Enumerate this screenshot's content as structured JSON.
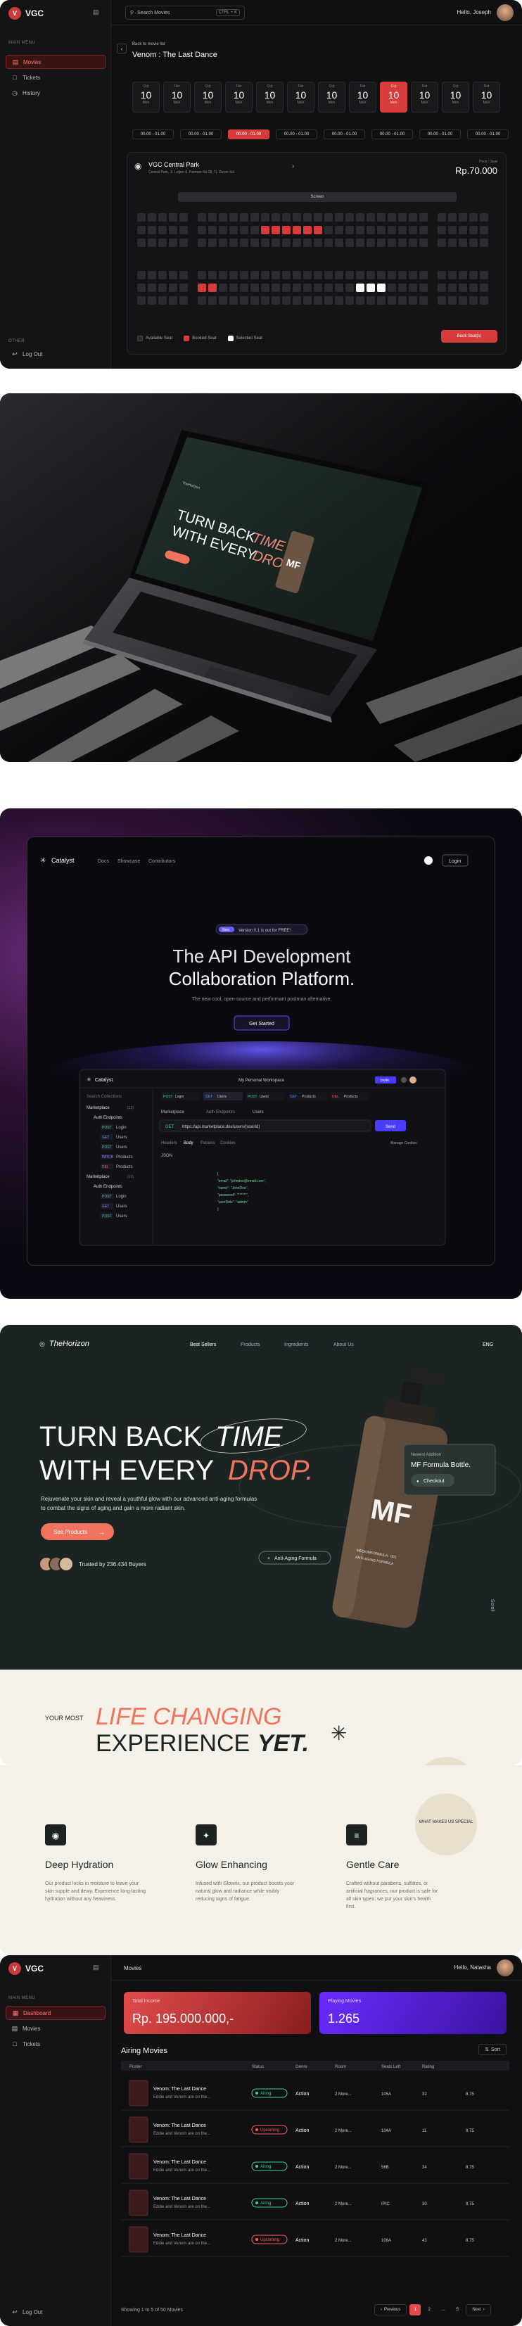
{
  "panel1": {
    "logo": "VGC",
    "sidebar": {
      "section_main": "MAIN MENU",
      "items": [
        {
          "label": "Movies",
          "icon": "film-icon"
        },
        {
          "label": "Tickets",
          "icon": "ticket-icon"
        },
        {
          "label": "History",
          "icon": "history-icon"
        }
      ],
      "section_other": "OTHER",
      "logout": "Log Out"
    },
    "search": {
      "placeholder": "Search Movies",
      "shortcut": "CTRL + K"
    },
    "greeting": "Hello, Joseph",
    "back_label": "Back to movie list",
    "movie_title": "Venom : The Last Dance",
    "dates": [
      {
        "m": "Oct",
        "d": "10",
        "w": "Mon"
      },
      {
        "m": "Oct",
        "d": "10",
        "w": "Mon"
      },
      {
        "m": "Oct",
        "d": "10",
        "w": "Mon"
      },
      {
        "m": "Oct",
        "d": "10",
        "w": "Mon"
      },
      {
        "m": "Oct",
        "d": "10",
        "w": "Mon"
      },
      {
        "m": "Oct",
        "d": "10",
        "w": "Mon"
      },
      {
        "m": "Oct",
        "d": "10",
        "w": "Mon"
      },
      {
        "m": "Oct",
        "d": "10",
        "w": "Mon"
      },
      {
        "m": "Oct",
        "d": "10",
        "w": "Mon"
      },
      {
        "m": "Oct",
        "d": "10",
        "w": "Mon"
      },
      {
        "m": "Oct",
        "d": "10",
        "w": "Mon"
      },
      {
        "m": "Oct",
        "d": "10",
        "w": "Mon"
      }
    ],
    "selected_date": 8,
    "times": [
      "00.00 - 01.00",
      "00.00 - 01.00",
      "00.00 - 01.00",
      "00.00 - 01.00",
      "00.00 - 01.00",
      "00.00 - 01.00",
      "00.00 - 01.00",
      "00.00 - 01.00"
    ],
    "selected_time": 2,
    "theatre": {
      "name": "VGC Central Park",
      "address": "Central Park, Jl. Letjen S. Parman No.28, Tj. Duren Sel.",
      "price_label": "Price / Seat",
      "price": "Rp.70.000"
    },
    "screen_label": "Screen",
    "legend": {
      "available": "Available Seat",
      "booked": "Booked Seat",
      "selected": "Selected Seat"
    },
    "book_button": "Book Seat(s)",
    "colors": {
      "accent": "#d63c3c",
      "seat": "#2c2c30",
      "selected": "#ffffff"
    }
  },
  "panel2": {
    "brand": "TheHorizon",
    "headline_1": "TURN BACK",
    "headline_1b": "TIME",
    "headline_2": "WITH EVERY",
    "headline_2b": "DROP.",
    "bottle_mark": "MF"
  },
  "panel3": {
    "brand": "Catalyst",
    "nav": [
      "Docs",
      "Showcase",
      "Contributors"
    ],
    "login": "Login",
    "badge_tag": "New",
    "badge_text": "Version 0.1 is out for FREE!",
    "headline_1": "The API Development",
    "headline_2": "Collaboration Platform.",
    "subtitle": "The new cool, open-source and performant postman alternative.",
    "cta": "Get Started",
    "app": {
      "brand": "Catalyst",
      "workspace": "My Personal Workspace",
      "invite": "Invite",
      "search_placeholder": "Search Collections",
      "tabs": [
        {
          "method": "POST",
          "name": "Login"
        },
        {
          "method": "GET",
          "name": "Users"
        },
        {
          "method": "POST",
          "name": "Users"
        },
        {
          "method": "GET",
          "name": "Products"
        },
        {
          "method": "DEL",
          "name": "Products"
        }
      ],
      "breadcrumb_1": "Marketplace",
      "breadcrumb_2": "Auth Endpoints",
      "breadcrumb_3": "Users",
      "method": "GET",
      "url": "https://api.marketplace.dev/users/{userId}",
      "send": "Send",
      "req_tabs": [
        "Headers",
        "Body",
        "Params",
        "Cookies"
      ],
      "manage_cookies": "Manage Cookies",
      "body_type": "JSON",
      "tree": [
        {
          "label": "Marketplace",
          "count": "(12)",
          "method": "",
          "indent": 0
        },
        {
          "label": "Auth Endpoints",
          "count": "",
          "method": "",
          "indent": 1
        },
        {
          "label": "Login",
          "count": "",
          "method": "POST",
          "indent": 2
        },
        {
          "label": "Users",
          "count": "",
          "method": "GET",
          "indent": 2
        },
        {
          "label": "Users",
          "count": "",
          "method": "POST",
          "indent": 2
        },
        {
          "label": "Products",
          "count": "",
          "method": "PATCH",
          "indent": 2
        },
        {
          "label": "Products",
          "count": "",
          "method": "DEL",
          "indent": 2
        },
        {
          "label": "Marketplace",
          "count": "(12)",
          "method": "",
          "indent": 0
        },
        {
          "label": "Auth Endpoints",
          "count": "",
          "method": "",
          "indent": 1
        },
        {
          "label": "Login",
          "count": "",
          "method": "POST",
          "indent": 2
        },
        {
          "label": "Users",
          "count": "",
          "method": "GET",
          "indent": 2
        },
        {
          "label": "Users",
          "count": "",
          "method": "POST",
          "indent": 2
        }
      ],
      "code": [
        "{",
        "  \"email\": \"johndoe@email.com\",",
        "  \"name\": \"JohnDoe\",",
        "  \"password\": \"******\",",
        "  \"userRole\": \"admin\"",
        "}"
      ]
    }
  },
  "panel4": {
    "brand": "TheHorizon",
    "nav": [
      "Best Sellers",
      "Products",
      "Ingredients",
      "About Us"
    ],
    "lang": "ENG",
    "headline_1": "TURN BACK",
    "headline_1b": "TIME",
    "headline_2": "WITH EVERY",
    "headline_2b": "DROP.",
    "desc_1": "Rejuvenate your skin and reveal a youthful glow with our advanced anti-aging formulas",
    "desc_2": "to combat the signs of aging and gain a more radiant skin.",
    "cta": "See Products",
    "trusted": "Trusted by 236.434 Buyers",
    "bottle_mark": "MF",
    "bottle_text": "MEDIUMFORMULA · 001",
    "bottle_sub": "ANTI-AGING FORMULA",
    "card_tag": "Newest Addition",
    "card_title": "MF Formula Bottle.",
    "card_btn": "Checkout",
    "tag_label": "Anti-Aging Formula",
    "scroll": "Scroll",
    "section_pre": "YOUR MOST",
    "section_italic": "LIFE CHANGING",
    "section_main": "EXPERIENCE",
    "section_bold": "YET.",
    "circle_text": "WHAT MAKES US SPECIAL",
    "features": [
      {
        "title": "Deep Hydration",
        "icon": "droplet-icon",
        "text": "Our product locks in moisture to leave your skin supple and dewy. Experience long-lasting hydration without any heaviness."
      },
      {
        "title": "Glow Enhancing",
        "icon": "sparkle-icon",
        "text": "Infused with Glowrix, our product boosts your natural glow and radiance while visibly reducing signs of fatigue."
      },
      {
        "title": "Gentle Care",
        "icon": "layers-icon",
        "text": "Crafted without parabens, sulfates, or artificial fragrances, our product is safe for all skin types; we put your skin's health first."
      }
    ],
    "colors": {
      "dark": "#1b2422",
      "coral": "#f0735e",
      "cream": "#f6f1e8"
    }
  },
  "panel5": {
    "logo": "VGC",
    "section_main": "MAIN MENU",
    "items": [
      {
        "label": "Dashboard",
        "icon": "grid-icon"
      },
      {
        "label": "Movies",
        "icon": "film-icon"
      },
      {
        "label": "Tickets",
        "icon": "ticket-icon"
      }
    ],
    "logout": "Log Out",
    "page_title": "Movies",
    "greeting": "Hello, Natasha",
    "stat_1": {
      "label": "Total Income",
      "value": "Rp. 195.000.000,-"
    },
    "stat_2": {
      "label": "Playing Movies",
      "value": "1.265"
    },
    "table_title": "Airing Movies",
    "sort_label": "Sort",
    "columns": [
      "Poster",
      "Status",
      "Genre",
      "Room",
      "Seats Left",
      "Rating"
    ],
    "rows": [
      {
        "title": "Venom: The Last Dance",
        "desc": "Eddie and Venom are on the...",
        "status": "Airing",
        "genre": "Action",
        "more": "2 More...",
        "room": "105A",
        "seats": "32",
        "rating": "8.75"
      },
      {
        "title": "Venom: The Last Dance",
        "desc": "Eddie and Venom are on the...",
        "status": "Upcoming",
        "genre": "Action",
        "more": "2 More...",
        "room": "104A",
        "seats": "11",
        "rating": "8.75"
      },
      {
        "title": "Venom: The Last Dance",
        "desc": "Eddie and Venom are on the...",
        "status": "Airing",
        "genre": "Action",
        "more": "2 More...",
        "room": "56B",
        "seats": "34",
        "rating": "8.75"
      },
      {
        "title": "Venom: The Last Dance",
        "desc": "Eddie and Venom are on the...",
        "status": "Airing",
        "genre": "Action",
        "more": "2 More...",
        "room": "IPIC",
        "seats": "30",
        "rating": "8.75"
      },
      {
        "title": "Venom: The Last Dance",
        "desc": "Eddie and Venom are on the...",
        "status": "Upcoming",
        "genre": "Action",
        "more": "2 More...",
        "room": "106A",
        "seats": "43",
        "rating": "8.75"
      }
    ],
    "showing": "Showing 1 to 5 of 50 Movies",
    "pagination": {
      "prev": "Previous",
      "pages": [
        "1",
        "2",
        "...",
        "5"
      ],
      "next": "Next"
    },
    "colors": {
      "airing": "#3ecf8e",
      "upcoming": "#ff5a5a",
      "income": "#e14b4b",
      "playing": "#6a2cff"
    }
  }
}
